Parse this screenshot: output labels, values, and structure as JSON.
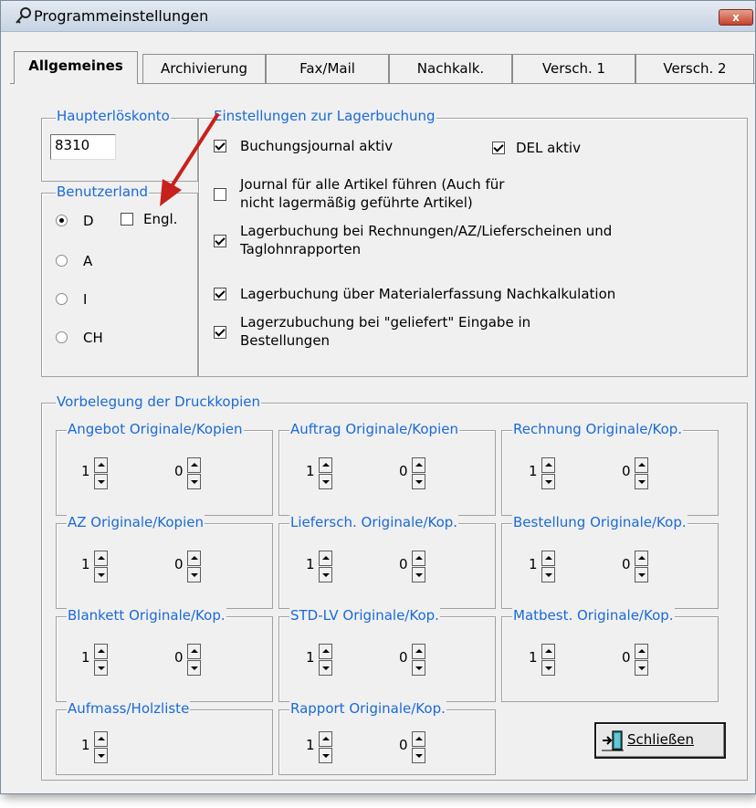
{
  "window": {
    "title": "Programmeinstellungen",
    "close_label": "x"
  },
  "tabs": [
    {
      "label": "Allgemeines"
    },
    {
      "label": "Archivierung"
    },
    {
      "label": "Fax/Mail"
    },
    {
      "label": "Nachkalk."
    },
    {
      "label": "Versch. 1"
    },
    {
      "label": "Versch. 2"
    }
  ],
  "haupterloeskonto": {
    "legend": "Haupterlöskonto",
    "value": "8310"
  },
  "benutzerland": {
    "legend": "Benutzerland",
    "engl_label": "Engl.",
    "options": [
      "D",
      "A",
      "I",
      "CH"
    ],
    "selected": "D"
  },
  "lagerbuchung": {
    "legend": "Einstellungen zur Lagerbuchung",
    "buchungsjournal": "Buchungsjournal aktiv",
    "del_aktiv": "DEL aktiv",
    "journal_line1": "Journal für alle Artikel führen (Auch für",
    "journal_line2": "nicht lagermäßig geführte Artikel)",
    "rechnungen_line1": "Lagerbuchung bei Rechnungen/AZ/Lieferscheinen und",
    "rechnungen_line2": "Taglohnrapporten",
    "material": "Lagerbuchung über Materialerfassung Nachkalkulation",
    "zubuchung_line1": "Lagerzubuchung bei \"geliefert\" Eingabe in",
    "zubuchung_line2": "Bestellungen"
  },
  "druckkopien": {
    "legend": "Vorbelegung der Druckkopien",
    "groups": [
      {
        "label": "Angebot Originale/Kopien",
        "orig": "1",
        "kopien": "0"
      },
      {
        "label": "Auftrag Originale/Kopien",
        "orig": "1",
        "kopien": "0"
      },
      {
        "label": "Rechnung Originale/Kop.",
        "orig": "1",
        "kopien": "0"
      },
      {
        "label": "AZ Originale/Kopien",
        "orig": "1",
        "kopien": "0"
      },
      {
        "label": "Liefersch. Originale/Kop.",
        "orig": "1",
        "kopien": "0"
      },
      {
        "label": "Bestellung Originale/Kop.",
        "orig": "1",
        "kopien": "0"
      },
      {
        "label": "Blankett Originale/Kop.",
        "orig": "1",
        "kopien": "0"
      },
      {
        "label": "STD-LV Originale/Kop.",
        "orig": "1",
        "kopien": "0"
      },
      {
        "label": "Matbest. Originale/Kop.",
        "orig": "1",
        "kopien": "0"
      },
      {
        "label": "Aufmass/Holzliste",
        "orig": "1"
      },
      {
        "label": "Rapport Originale/Kop.",
        "orig": "1",
        "kopien": "0"
      }
    ]
  },
  "close_button": {
    "label": "Schließen",
    "icon": "exit-door-icon"
  },
  "annotation": {
    "arrow_color": "#c8201c"
  }
}
